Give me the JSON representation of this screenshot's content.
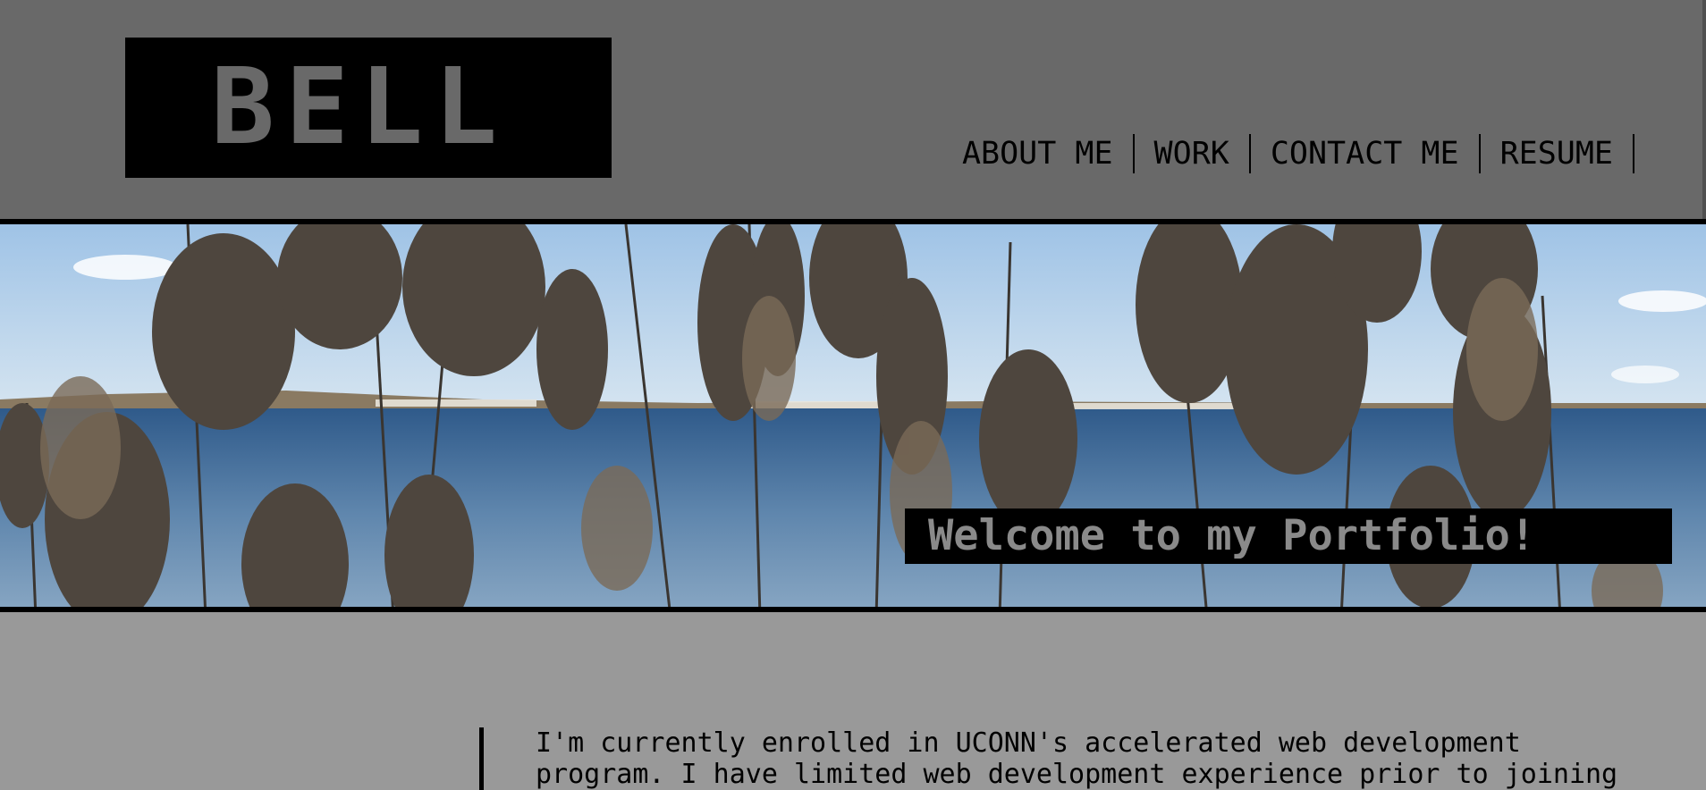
{
  "header": {
    "logo_text": "BELL",
    "nav": [
      {
        "label": "ABOUT ME"
      },
      {
        "label": "WORK"
      },
      {
        "label": "CONTACT ME"
      },
      {
        "label": "RESUME"
      }
    ]
  },
  "hero": {
    "welcome_text": "Welcome to my Portfolio!"
  },
  "about": {
    "text": "I'm currently enrolled in UCONN's accelerated web development program. I have limited web development experience prior to joining"
  },
  "colors": {
    "header_bg": "#696969",
    "body_bg": "#999999",
    "accent_black": "#000000",
    "logo_text": "#696969",
    "welcome_text": "#8a8a8a"
  }
}
